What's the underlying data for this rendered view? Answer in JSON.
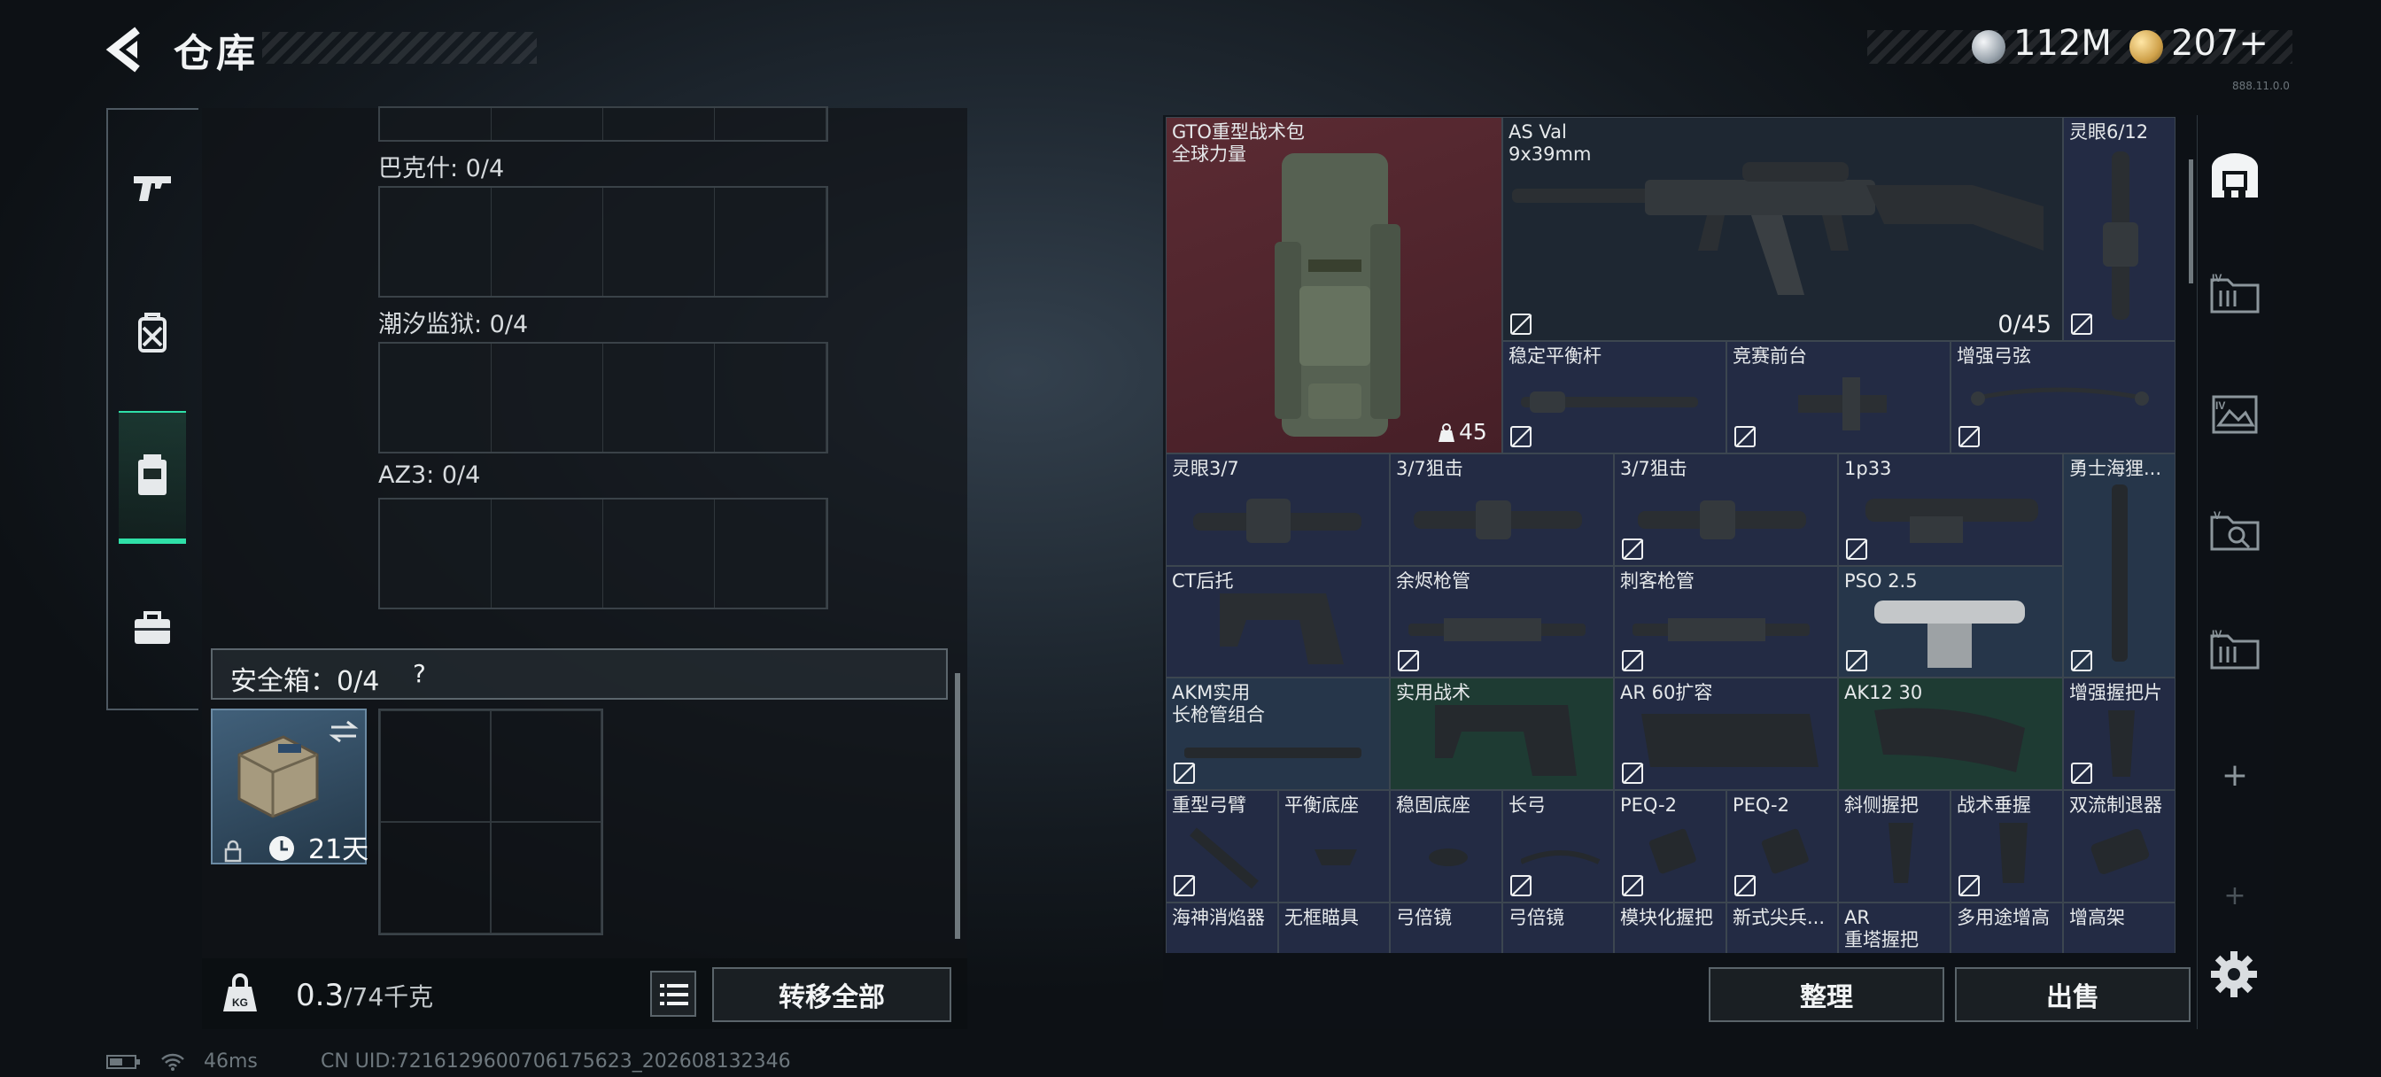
{
  "header": {
    "title": "仓库",
    "silver": "112M",
    "gold": "207+",
    "version": "888.11.0.0"
  },
  "left_nav": {
    "items": [
      "pistol-icon",
      "backpack-icon",
      "chest-rig-icon",
      "case-icon"
    ],
    "active": 2
  },
  "containers": [
    {
      "label": "巴克什: 0/4"
    },
    {
      "label": "潮汐监狱: 0/4"
    },
    {
      "label": "AZ3: 0/4"
    }
  ],
  "safe_box": {
    "label": "安全箱：0/4",
    "help": "?",
    "days": "21天"
  },
  "bottom": {
    "weight_current": "0.3",
    "weight_max": "/74千克",
    "transfer_all": "转移全部"
  },
  "status": {
    "ping": "46ms",
    "uid": "CN UID:7216129600706175623_202608132346"
  },
  "stash_items": [
    {
      "name": "GTO重型战术包\n全球力量",
      "badge": "45"
    },
    {
      "name": "AS Val\n9x39mm",
      "ammo": "0/45"
    },
    {
      "name": "灵眼6/12"
    },
    {
      "name": "稳定平衡杆"
    },
    {
      "name": "竞赛前台"
    },
    {
      "name": "增强弓弦"
    },
    {
      "name": "灵眼3/7"
    },
    {
      "name": "3/7狙击"
    },
    {
      "name": "3/7狙击"
    },
    {
      "name": "1p33"
    },
    {
      "name": "勇士海狸..."
    },
    {
      "name": "CT后托"
    },
    {
      "name": "余烬枪管"
    },
    {
      "name": "刺客枪管"
    },
    {
      "name": "PSO 2.5"
    },
    {
      "name": "AKM实用\n长枪管组合"
    },
    {
      "name": "实用战术"
    },
    {
      "name": "AR 60扩容"
    },
    {
      "name": "AK12 30"
    },
    {
      "name": "增强握把片"
    },
    {
      "name": "重型弓臂"
    },
    {
      "name": "平衡底座"
    },
    {
      "name": "稳固底座"
    },
    {
      "name": "长弓"
    },
    {
      "name": "PEQ-2"
    },
    {
      "name": "PEQ-2"
    },
    {
      "name": "斜侧握把"
    },
    {
      "name": "战术垂握"
    },
    {
      "name": "双流制退器"
    },
    {
      "name": "海神消焰器"
    },
    {
      "name": "无框瞄具"
    },
    {
      "name": "弓倍镜"
    },
    {
      "name": "弓倍镜"
    },
    {
      "name": "模块化握把"
    },
    {
      "name": "新式尖兵..."
    },
    {
      "name": "AR\n重塔握把"
    },
    {
      "name": "多用途增高"
    },
    {
      "name": "增高架"
    }
  ],
  "right_side": {
    "tabs": [
      "pouch-icon",
      "tier4-box-icon",
      "image-box-icon",
      "tier5-search-icon",
      "tier4-box-icon"
    ],
    "add": "+"
  },
  "actions": {
    "sort": "整理",
    "sell": "出售"
  }
}
